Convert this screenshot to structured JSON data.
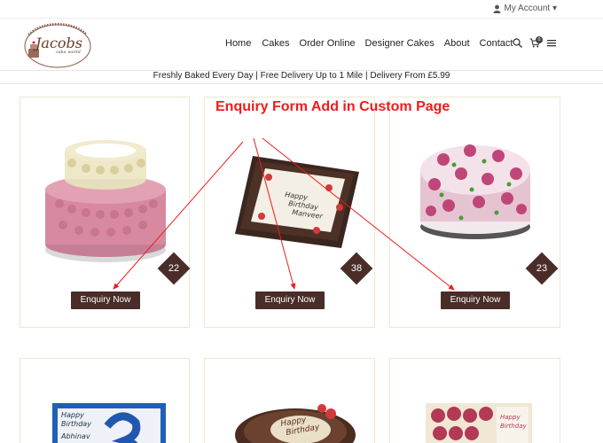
{
  "topbar": {
    "account_label": "My Account ▾"
  },
  "logo": {
    "name": "Jacobs",
    "tagline": "cake world"
  },
  "nav": {
    "items": [
      "Home",
      "Cakes",
      "Order Online",
      "Designer Cakes",
      "About",
      "Contact"
    ]
  },
  "header_icons": {
    "cart_count": "0"
  },
  "promo": {
    "text": "Freshly Baked Every Day | Free Delivery Up to 1 Mile | Delivery From £5.99"
  },
  "annotation": {
    "text": "Enquiry Form Add in Custom Page"
  },
  "products": [
    {
      "count": "22",
      "button": "Enquiry Now"
    },
    {
      "count": "38",
      "button": "Enquiry Now"
    },
    {
      "count": "23",
      "button": "Enquiry Now"
    }
  ],
  "cake_writing": {
    "card2": [
      "Happy",
      "Birthday",
      "Manveer"
    ],
    "card4": [
      "Happy",
      "Birthday",
      "Abhinav"
    ],
    "card5": [
      "Happy",
      "Birthday"
    ],
    "card6": [
      "Happy",
      "Birthday"
    ]
  },
  "colors": {
    "accent": "#4a2d28",
    "annotation": "#ee1c1c",
    "card_border": "#f1e6cf"
  }
}
